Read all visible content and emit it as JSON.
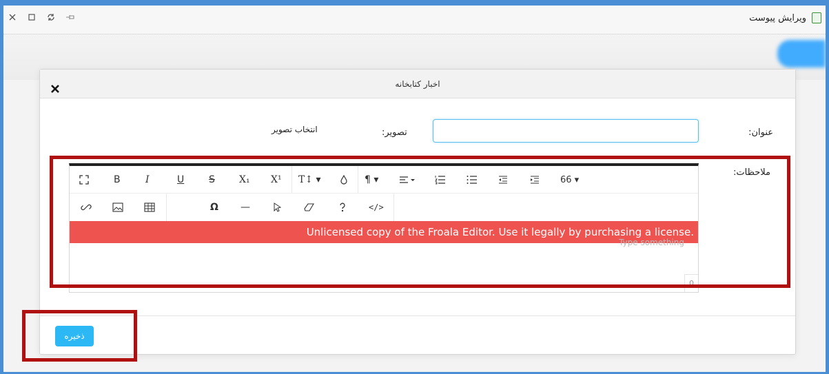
{
  "window": {
    "title": "ویرایش پیوست",
    "controls": [
      "close-icon",
      "maximize-icon",
      "refresh-icon",
      "pin-icon"
    ]
  },
  "modal": {
    "title": "اخبار کتابخانه",
    "fields": {
      "title_label": "عنوان:",
      "title_value": "",
      "image_label": "تصویر:",
      "image_pick": "انتخاب تصویر",
      "notes_label": "ملاحظات:"
    },
    "editor": {
      "toolbar_row1": [
        {
          "name": "fullscreen-icon",
          "glyph": "⛶"
        },
        {
          "name": "bold-icon",
          "glyph": "B"
        },
        {
          "name": "italic-icon",
          "glyph": "I"
        },
        {
          "name": "underline-icon",
          "glyph": "U"
        },
        {
          "name": "strikethrough-icon",
          "glyph": "S"
        },
        {
          "name": "subscript-icon",
          "glyph": "X₁"
        },
        {
          "name": "superscript-icon",
          "glyph": "X¹"
        },
        {
          "name": "font-size-icon",
          "glyph": "T↕ ▾"
        },
        {
          "name": "color-icon",
          "glyph": "◊"
        },
        {
          "name": "paragraph-format-icon",
          "glyph": "¶ ▾"
        },
        {
          "name": "align-icon",
          "glyph": "≡ ▾"
        },
        {
          "name": "ordered-list-icon",
          "glyph": "⋮≡"
        },
        {
          "name": "unordered-list-icon",
          "glyph": "⁝≡"
        },
        {
          "name": "outdent-icon",
          "glyph": "⇤≡"
        },
        {
          "name": "indent-icon",
          "glyph": "⇥≡"
        },
        {
          "name": "quote-icon",
          "glyph": "66 ▾"
        }
      ],
      "toolbar_row2": [
        {
          "name": "link-icon",
          "glyph": "🔗"
        },
        {
          "name": "image-icon",
          "glyph": "▣"
        },
        {
          "name": "table-icon",
          "glyph": "⊞"
        },
        {
          "name": "special-char-icon",
          "glyph": "Ω"
        },
        {
          "name": "horizontal-line-icon",
          "glyph": "—"
        },
        {
          "name": "select-all-icon",
          "glyph": "⇖"
        },
        {
          "name": "clear-format-icon",
          "glyph": "⌫"
        },
        {
          "name": "help-icon",
          "glyph": "?"
        },
        {
          "name": "code-view-icon",
          "glyph": "</>"
        }
      ],
      "banner": "Unlicensed copy of the Froala Editor. Use it legally by purchasing a license.",
      "placeholder": "Type something",
      "char_count": "0"
    },
    "save_label": "ذخیره"
  },
  "colors": {
    "accent": "#2bb8f5",
    "banner": "#ef5350",
    "highlight": "#b01010"
  }
}
